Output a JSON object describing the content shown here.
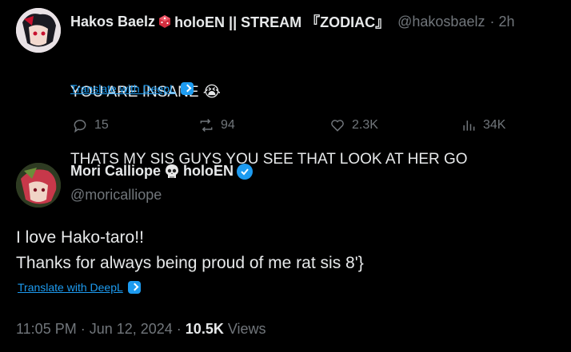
{
  "reply": {
    "author_name_part1": "Hakos Baelz",
    "author_name_part2": "holoEN || STREAM 『ZODIAC』",
    "handle": "@hakosbaelz",
    "time": "· 2h",
    "text_line1": "YOU ARE INSANE 😭",
    "text_line2": "THATS MY SIS GUYS YOU SEE THAT LOOK AT HER GO",
    "translate_label": "Translate with DeepL",
    "replies": "15",
    "reposts": "94",
    "likes": "2.3K",
    "views": "34K"
  },
  "tweet": {
    "author_name_part1": "Mori Calliope",
    "author_name_part2": "holoEN",
    "handle": "@moricalliope",
    "text_line1": "I love Hako-taro!!",
    "text_line2": "Thanks for always being proud of me rat sis 8'}",
    "translate_label": "Translate with DeepL",
    "timestamp": "11:05 PM · Jun 12, 2024 · ",
    "view_count": "10.5K",
    "views_label": " Views"
  },
  "colors": {
    "background": "#000000",
    "text": "#e7e9ea",
    "muted": "#71767b",
    "accent": "#1d9bf0"
  },
  "icons": [
    "dice-icon",
    "skull-icon",
    "verified-badge-icon",
    "deepl-icon",
    "reply-icon",
    "repost-icon",
    "like-icon",
    "views-icon"
  ]
}
